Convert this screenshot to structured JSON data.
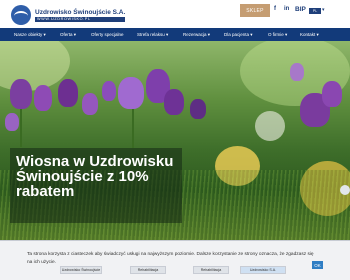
{
  "header": {
    "logo_name": "Uzdrowisko Świnoujście S.A.",
    "logo_url": "WWW.UZDROWISKO.PL",
    "shop_label": "SKLEP",
    "facebook_label": "f",
    "linkedin_label": "in",
    "bip_label": "BIP",
    "lang_label": "PL",
    "lang_caret": "▾"
  },
  "nav": {
    "items": [
      {
        "label": "Nasze obiekty ▾"
      },
      {
        "label": "Oferta ▾"
      },
      {
        "label": "Oferty specjalne"
      },
      {
        "label": "Strefa relaksu ▾"
      },
      {
        "label": "Rezerwacja ▾"
      },
      {
        "label": "Dla pacjenta ▾"
      },
      {
        "label": "O firmie ▾"
      },
      {
        "label": "Kontakt ▾"
      }
    ]
  },
  "hero": {
    "title": "Wiosna w Uzdrowisku Świnoujście z 10% rabatem"
  },
  "cookie": {
    "text": "Ta strona korzysta z ciasteczek aby świadczyć usługi na najwyższym poziomie. Dalsze korzystanie ze strony oznacza, że zgadzasz się na ich użycie.",
    "ok_label": "OK",
    "buttons": [
      {
        "label": "Uzdrowisko Świnoujście"
      },
      {
        "label": "Rehabilitacja"
      },
      {
        "label": "Rehabilitacja"
      },
      {
        "label": "Uzdrowisko S.A."
      }
    ]
  },
  "colors": {
    "brand": "#123a7a",
    "shop_button": "#c59d72",
    "ok_button": "#2f7ec4"
  }
}
